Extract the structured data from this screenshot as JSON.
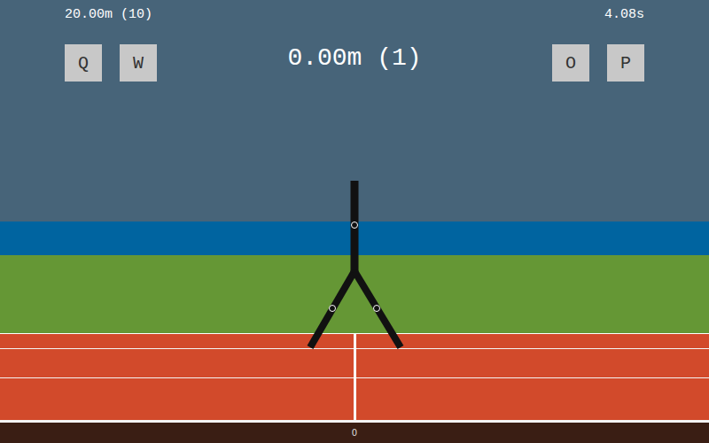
{
  "hud": {
    "best": "20.00m (10)",
    "time": "4.08s",
    "distance": "0.00m (1)"
  },
  "keys": [
    {
      "label": "Q",
      "side": "left"
    },
    {
      "label": "W",
      "side": "left"
    },
    {
      "label": "O",
      "side": "right"
    },
    {
      "label": "P",
      "side": "right"
    }
  ],
  "track": {
    "marker": "0"
  }
}
